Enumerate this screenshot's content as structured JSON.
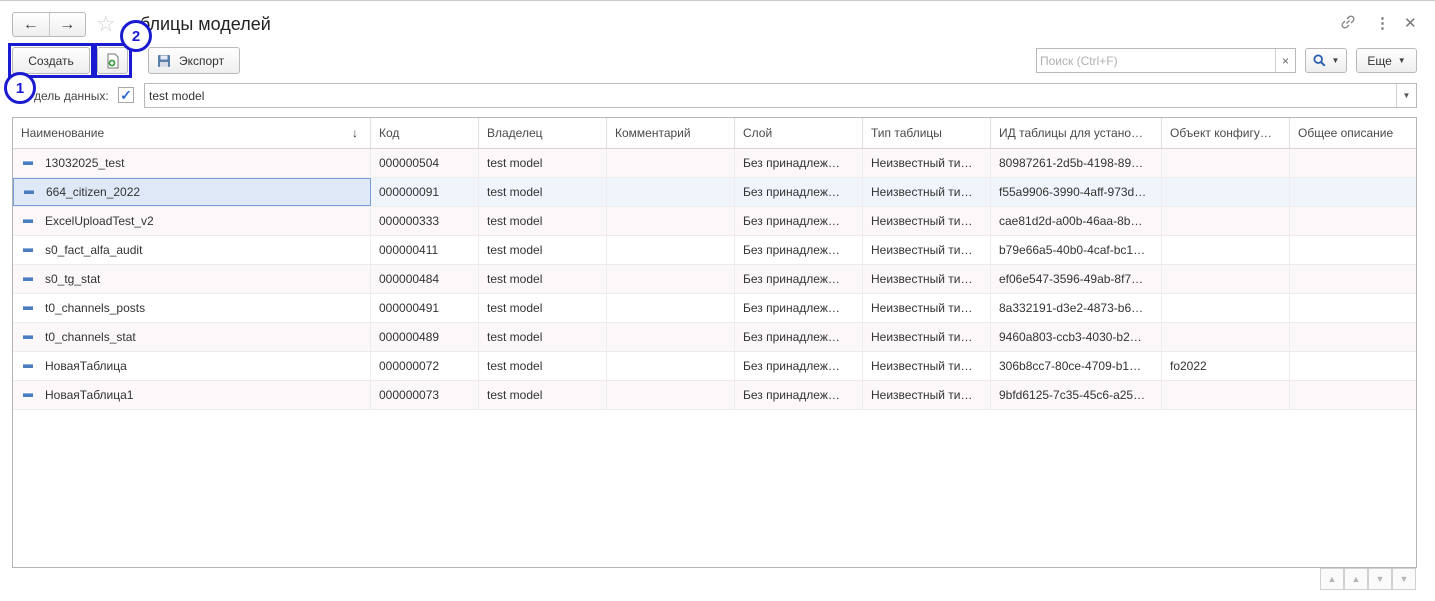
{
  "window": {
    "title": "Таблицы моделей",
    "title_visible": "блицы моделей"
  },
  "nav": {
    "back_icon": "arrow-left",
    "forward_icon": "arrow-right",
    "favorite_icon": "star"
  },
  "header_icons": {
    "link_icon": "link",
    "menu_icon": "more-vertical",
    "close_icon": "close"
  },
  "toolbar": {
    "create_label": "Создать",
    "export_label": "Экспорт",
    "more_label": "Еще",
    "search_placeholder": "Поиск (Ctrl+F)",
    "search_clear": "×",
    "search_icon": "magnifier"
  },
  "callouts": [
    {
      "number": "1"
    },
    {
      "number": "2"
    }
  ],
  "filter": {
    "label": "дель данных:",
    "checked": true,
    "value": "test model"
  },
  "table": {
    "columns": [
      "Наименование",
      "Код",
      "Владелец",
      "Комментарий",
      "Слой",
      "Тип таблицы",
      "ИД таблицы для устано…",
      "Объект конфигу…",
      "Общее описание"
    ],
    "sort_indicator": "↓",
    "rows": [
      {
        "name": "13032025_test",
        "code": "000000504",
        "owner": "test model",
        "comment": "",
        "layer": "Без принадлеж…",
        "type": "Неизвестный ти…",
        "id": "80987261-2d5b-4198-89…",
        "object": "",
        "description": ""
      },
      {
        "name": "664_citizen_2022",
        "code": "000000091",
        "owner": "test model",
        "comment": "",
        "layer": "Без принадлеж…",
        "type": "Неизвестный ти…",
        "id": "f55a9906-3990-4aff-973d…",
        "object": "",
        "description": ""
      },
      {
        "name": "ExcelUploadTest_v2",
        "code": "000000333",
        "owner": "test model",
        "comment": "",
        "layer": "Без принадлеж…",
        "type": "Неизвестный ти…",
        "id": "cae81d2d-a00b-46aa-8b…",
        "object": "",
        "description": ""
      },
      {
        "name": "s0_fact_alfa_audit",
        "code": "000000411",
        "owner": "test model",
        "comment": "",
        "layer": "Без принадлеж…",
        "type": "Неизвестный ти…",
        "id": "b79e66a5-40b0-4caf-bc1…",
        "object": "",
        "description": ""
      },
      {
        "name": "s0_tg_stat",
        "code": "000000484",
        "owner": "test model",
        "comment": "",
        "layer": "Без принадлеж…",
        "type": "Неизвестный ти…",
        "id": "ef06e547-3596-49ab-8f7…",
        "object": "",
        "description": ""
      },
      {
        "name": "t0_channels_posts",
        "code": "000000491",
        "owner": "test model",
        "comment": "",
        "layer": "Без принадлеж…",
        "type": "Неизвестный ти…",
        "id": "8a332191-d3e2-4873-b6…",
        "object": "",
        "description": ""
      },
      {
        "name": "t0_channels_stat",
        "code": "000000489",
        "owner": "test model",
        "comment": "",
        "layer": "Без принадлеж…",
        "type": "Неизвестный ти…",
        "id": "9460a803-ccb3-4030-b2…",
        "object": "",
        "description": ""
      },
      {
        "name": "НоваяТаблица",
        "code": "000000072",
        "owner": "test model",
        "comment": "",
        "layer": "Без принадлеж…",
        "type": "Неизвестный ти…",
        "id": "306b8cc7-80ce-4709-b1…",
        "object": "fo2022",
        "description": ""
      },
      {
        "name": "НоваяТаблица1",
        "code": "000000073",
        "owner": "test model",
        "comment": "",
        "layer": "Без принадлеж…",
        "type": "Неизвестный ти…",
        "id": "9bfd6125-7c35-45c6-a25…",
        "object": "",
        "description": ""
      }
    ],
    "selected_row": 1
  },
  "pager": {
    "first_icon": "double-up",
    "prev_icon": "up",
    "next_icon": "down",
    "last_icon": "double-down"
  },
  "colors": {
    "callout": "#1a1ad0",
    "selected_row": "#dfe8f7",
    "row_icon": "#4a7cc0"
  }
}
